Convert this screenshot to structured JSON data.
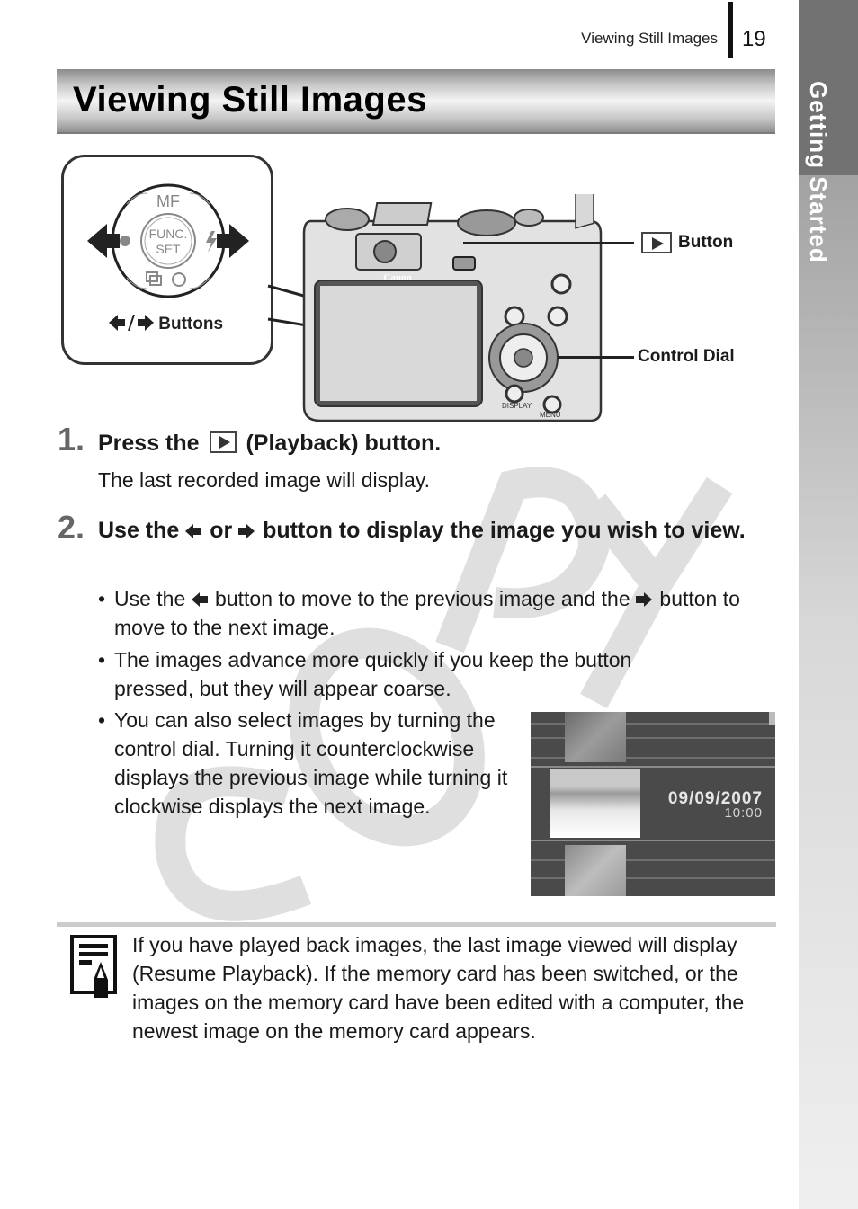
{
  "header": {
    "section_title": "Viewing Still Images",
    "page_number": "19"
  },
  "side_tab": {
    "label": "Getting Started"
  },
  "title": "Viewing Still Images",
  "diagram": {
    "inset": {
      "dial_top": "MF",
      "dial_center_line1": "FUNC.",
      "dial_center_line2": "SET",
      "caption_arrows": "⬅/➡",
      "caption": "Buttons"
    },
    "camera": {
      "brand": "Canon",
      "left_button": "DISPLAY",
      "right_button": "MENU",
      "dial_label": "MF"
    },
    "callouts": [
      {
        "icon": "play-icon",
        "label": "Button"
      },
      {
        "label": "Control Dial"
      }
    ]
  },
  "steps": [
    {
      "number": "1.",
      "title_before": "Press the",
      "title_after": "(Playback) button.",
      "description": "The last recorded image will display."
    },
    {
      "number": "2.",
      "title_part1": "Use the",
      "title_part2": "or",
      "title_part3": "button to display the image you wish to view.",
      "bullets": [
        {
          "part1": "Use the",
          "part2": "button to move to the previous image and the",
          "part3": "button to move to the next image."
        },
        {
          "text": "The images advance more quickly if you keep the button pressed, but they will appear coarse."
        },
        {
          "text": "You can also select images by turning the control dial. Turning it counterclockwise displays the previous image while turning it clockwise displays the next image."
        }
      ]
    }
  ],
  "screen": {
    "date": "09/09/2007",
    "time": "10:00"
  },
  "note": {
    "text": "If you have played back images, the last image viewed will display (Resume Playback). If the memory card has been switched, or the images on the memory card have been edited with a computer, the newest image on the memory card appears."
  },
  "watermark": "COPY"
}
